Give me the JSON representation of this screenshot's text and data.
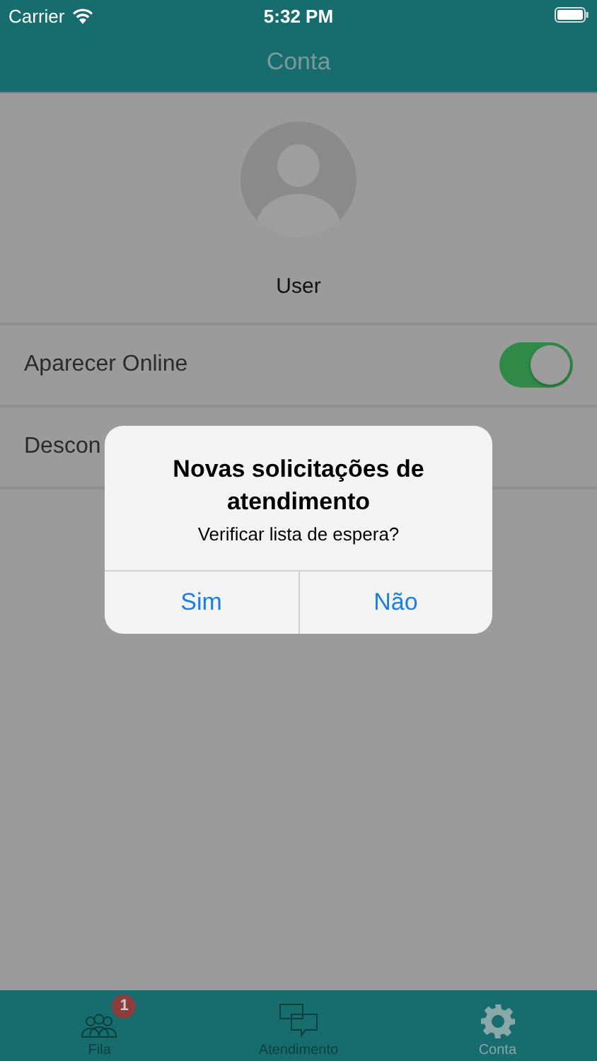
{
  "status_bar": {
    "carrier": "Carrier",
    "time": "5:32 PM"
  },
  "nav_bar": {
    "title": "Conta"
  },
  "profile": {
    "name": "User"
  },
  "settings": [
    {
      "kind": "toggle",
      "label": "Aparecer Online",
      "on": true
    },
    {
      "kind": "plain",
      "label": "Descon"
    }
  ],
  "alert": {
    "title": "Novas solicitações de atendimento",
    "message": "Verificar lista de espera?",
    "buttons": [
      "Sim",
      "Não"
    ]
  },
  "tab_bar": [
    {
      "label": "Fila",
      "kind": "people",
      "badge": "1",
      "selected": false
    },
    {
      "label": "Atendimento",
      "kind": "chat",
      "selected": false
    },
    {
      "label": "Conta",
      "kind": "gear",
      "selected": true
    }
  ]
}
